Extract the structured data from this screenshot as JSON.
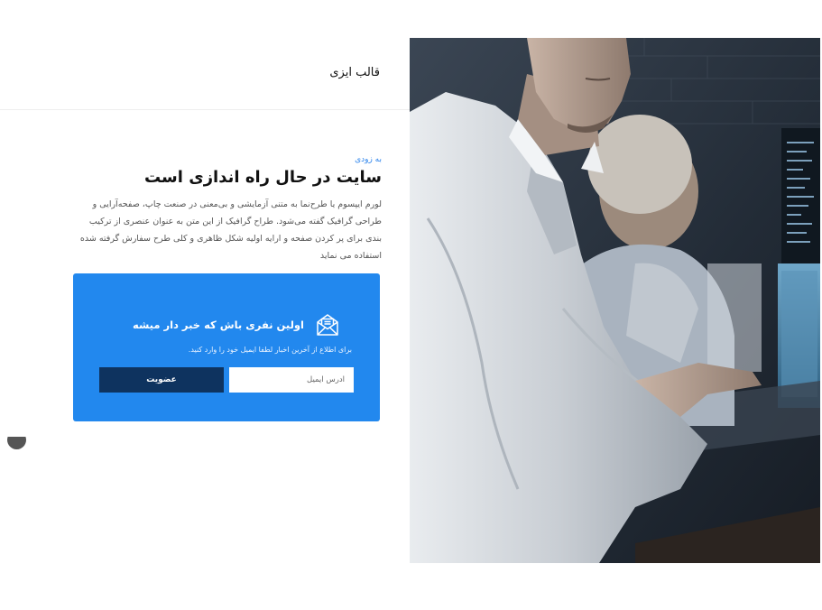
{
  "header": {
    "brand": "قالب ایزی"
  },
  "hero": {
    "kicker": "به زودی",
    "title": "سایت در حال راه اندازی است",
    "description": "لورم ایپسوم یا طرح‌نما به متنی آزمایشی و بی‌معنی در صنعت چاپ، صفحه‌آرایی و طراحی گرافیک گفته می‌شود. طراح گرافیک از این متن به عنوان عنصری از ترکیب بندی برای پر کردن صفحه و ارایه اولیه شکل ظاهری و کلی طرح سفارش گرفته شده استفاده می نماید"
  },
  "newsletter": {
    "icon": "mail-icon",
    "title": "اولین نفری باش که خبر دار میشه",
    "subtitle": "برای اطلاع از آخرین اخبار لطفا ایمیل خود را وارد کنید.",
    "email_placeholder": "آدرس ایمیل",
    "email_value": "",
    "submit_label": "عضویت"
  },
  "colors": {
    "accent": "#2288ee",
    "button": "#0e335f",
    "kicker": "#2d84ec"
  }
}
